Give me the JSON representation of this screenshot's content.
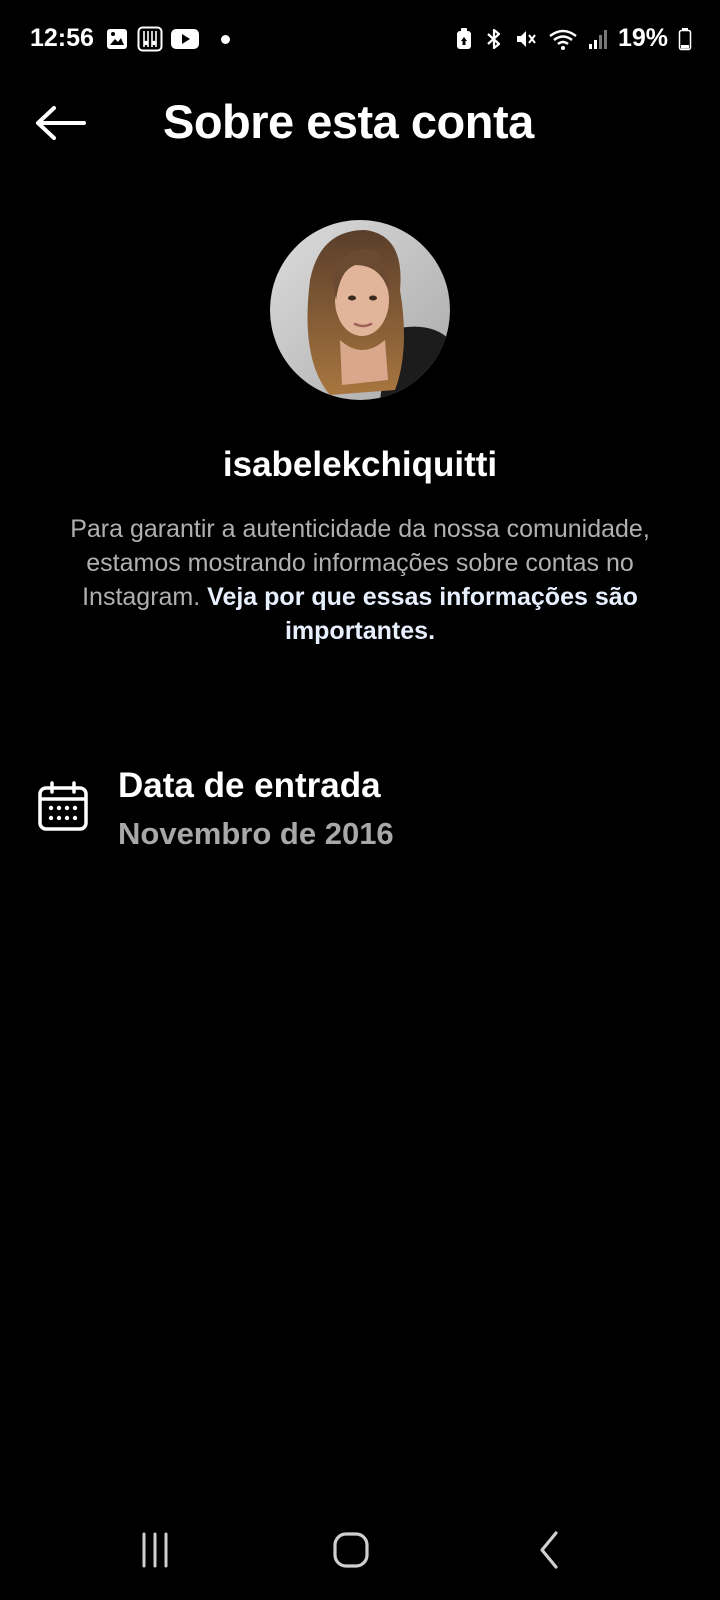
{
  "status_bar": {
    "time": "12:56",
    "battery": "19%",
    "icons": [
      "gallery-icon",
      "app-grid-icon",
      "youtube-icon",
      "notification-dot",
      "battery-saver-icon",
      "bluetooth-icon",
      "mute-icon",
      "wifi-icon",
      "signal-icon",
      "battery-icon"
    ]
  },
  "header": {
    "title": "Sobre esta conta",
    "back_icon": "arrow-left-icon"
  },
  "profile": {
    "username": "isabelekchiquitti",
    "info_text": "Para garantir a autenticidade da nossa comunidade, estamos mostrando informações sobre contas no Instagram.",
    "info_link": "Veja por que essas informações são importantes."
  },
  "details": {
    "join_label": "Data de entrada",
    "join_value": "Novembro de 2016",
    "join_icon": "calendar-icon"
  },
  "nav": {
    "icons": [
      "recent-apps-icon",
      "home-icon",
      "back-icon"
    ]
  },
  "colors": {
    "background": "#000000",
    "primary_text": "#ffffff",
    "secondary_text": "#a8a8a8",
    "link_text": "#e8f0ff"
  }
}
